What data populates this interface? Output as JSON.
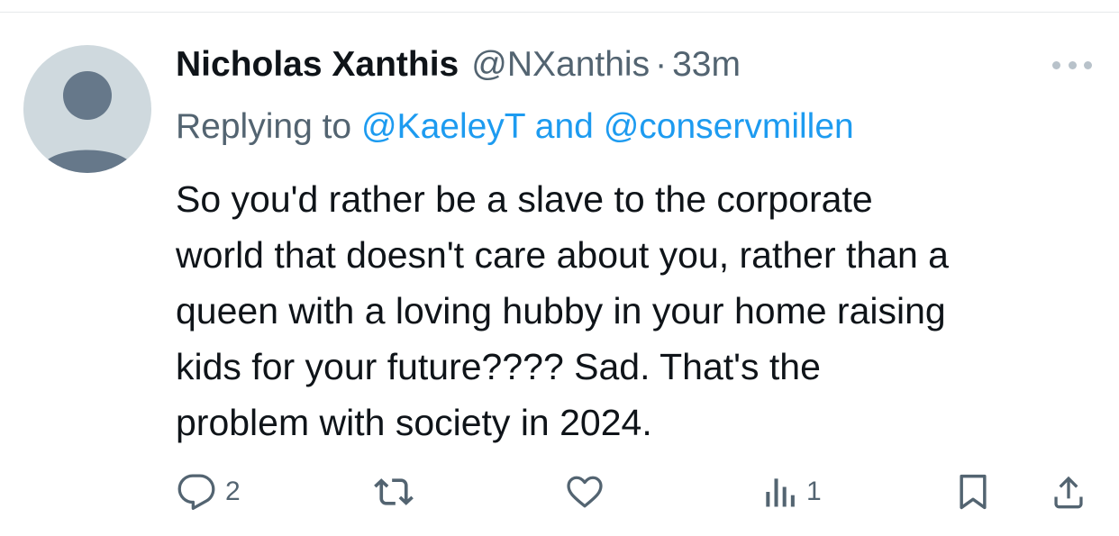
{
  "tweet": {
    "author_name": "Nicholas Xanthis",
    "author_handle": "@NXanthis",
    "separator": "·",
    "timestamp": "33m",
    "replying_prefix": "Replying to",
    "reply_mention_1": "@KaeleyT",
    "reply_conjunction": "and",
    "reply_mention_2": "@conservmillen",
    "text": "So you'd rather be a slave to the corporate\nworld that doesn't care about you, rather than a\nqueen with a loving hubby  in your home raising\nkids for your future???? Sad. That's the\nproblem with society in 2024."
  },
  "actions": {
    "reply_count": "2",
    "views_count": "1"
  },
  "icons": {
    "avatar": "default-avatar-icon",
    "more": "more-options-icon",
    "reply": "reply-icon",
    "retweet": "retweet-icon",
    "like": "heart-icon",
    "views": "views-icon",
    "bookmark": "bookmark-icon",
    "share": "share-icon"
  },
  "colors": {
    "link": "#1d9bf0",
    "secondary_text": "#536471",
    "primary_text": "#0f1419",
    "avatar_bg": "#cfd9de",
    "avatar_figure": "#66788a"
  }
}
